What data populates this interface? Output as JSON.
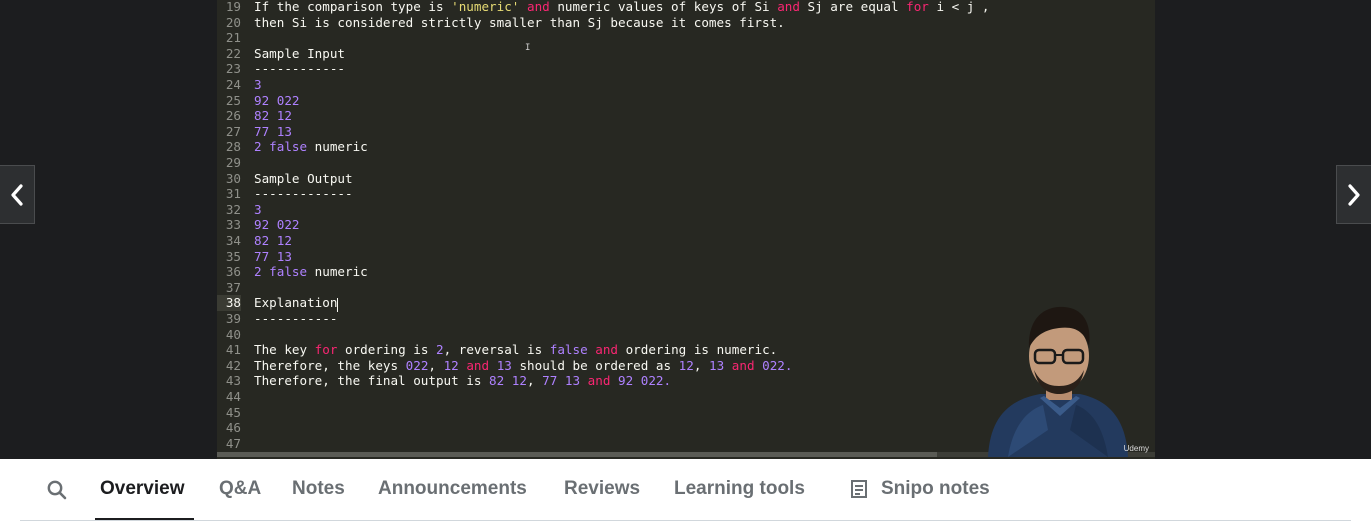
{
  "editor": {
    "active_line": "38",
    "lines": [
      {
        "n": "19",
        "tokens": [
          {
            "t": "If the comparison type is ",
            "c": "plain"
          },
          {
            "t": "'numeric'",
            "c": "str"
          },
          {
            "t": " ",
            "c": "plain"
          },
          {
            "t": "and",
            "c": "kw"
          },
          {
            "t": " numeric values of keys of Si ",
            "c": "plain"
          },
          {
            "t": "and",
            "c": "kw"
          },
          {
            "t": " Sj are equal ",
            "c": "plain"
          },
          {
            "t": "for",
            "c": "kw"
          },
          {
            "t": " i < j ,",
            "c": "plain"
          }
        ]
      },
      {
        "n": "20",
        "tokens": [
          {
            "t": "then Si is considered strictly smaller than Sj because it comes first.",
            "c": "plain"
          }
        ]
      },
      {
        "n": "21",
        "tokens": []
      },
      {
        "n": "22",
        "tokens": [
          {
            "t": "Sample Input",
            "c": "plain"
          }
        ]
      },
      {
        "n": "23",
        "tokens": [
          {
            "t": "------------",
            "c": "plain"
          }
        ]
      },
      {
        "n": "24",
        "tokens": [
          {
            "t": "3",
            "c": "num"
          }
        ]
      },
      {
        "n": "25",
        "tokens": [
          {
            "t": "92 022",
            "c": "num"
          }
        ]
      },
      {
        "n": "26",
        "tokens": [
          {
            "t": "82 12",
            "c": "num"
          }
        ]
      },
      {
        "n": "27",
        "tokens": [
          {
            "t": "77 13",
            "c": "num"
          }
        ]
      },
      {
        "n": "28",
        "tokens": [
          {
            "t": "2 false",
            "c": "num"
          },
          {
            "t": " numeric",
            "c": "plain"
          }
        ]
      },
      {
        "n": "29",
        "tokens": []
      },
      {
        "n": "30",
        "tokens": [
          {
            "t": "Sample Output",
            "c": "plain"
          }
        ]
      },
      {
        "n": "31",
        "tokens": [
          {
            "t": "-------------",
            "c": "plain"
          }
        ]
      },
      {
        "n": "32",
        "tokens": [
          {
            "t": "3",
            "c": "num"
          }
        ]
      },
      {
        "n": "33",
        "tokens": [
          {
            "t": "92 022",
            "c": "num"
          }
        ]
      },
      {
        "n": "34",
        "tokens": [
          {
            "t": "82 12",
            "c": "num"
          }
        ]
      },
      {
        "n": "35",
        "tokens": [
          {
            "t": "77 13",
            "c": "num"
          }
        ]
      },
      {
        "n": "36",
        "tokens": [
          {
            "t": "2 false",
            "c": "num"
          },
          {
            "t": " numeric",
            "c": "plain"
          }
        ]
      },
      {
        "n": "37",
        "tokens": []
      },
      {
        "n": "38",
        "tokens": [
          {
            "t": "Explanation",
            "c": "plain"
          }
        ]
      },
      {
        "n": "39",
        "tokens": [
          {
            "t": "-----------",
            "c": "plain"
          }
        ]
      },
      {
        "n": "40",
        "tokens": []
      },
      {
        "n": "41",
        "tokens": [
          {
            "t": "The key ",
            "c": "plain"
          },
          {
            "t": "for",
            "c": "kw"
          },
          {
            "t": " ordering is ",
            "c": "plain"
          },
          {
            "t": "2",
            "c": "num"
          },
          {
            "t": ", reversal is ",
            "c": "plain"
          },
          {
            "t": "false",
            "c": "num"
          },
          {
            "t": " ",
            "c": "plain"
          },
          {
            "t": "and",
            "c": "kw"
          },
          {
            "t": " ordering is numeric.",
            "c": "plain"
          }
        ]
      },
      {
        "n": "42",
        "tokens": [
          {
            "t": "Therefore, the keys ",
            "c": "plain"
          },
          {
            "t": "022",
            "c": "num"
          },
          {
            "t": ", ",
            "c": "plain"
          },
          {
            "t": "12",
            "c": "num"
          },
          {
            "t": " ",
            "c": "plain"
          },
          {
            "t": "and",
            "c": "kw"
          },
          {
            "t": " ",
            "c": "plain"
          },
          {
            "t": "13",
            "c": "num"
          },
          {
            "t": " should be ordered as ",
            "c": "plain"
          },
          {
            "t": "12",
            "c": "num"
          },
          {
            "t": ", ",
            "c": "plain"
          },
          {
            "t": "13",
            "c": "num"
          },
          {
            "t": " ",
            "c": "plain"
          },
          {
            "t": "and",
            "c": "kw"
          },
          {
            "t": " ",
            "c": "plain"
          },
          {
            "t": "022.",
            "c": "num"
          }
        ]
      },
      {
        "n": "43",
        "tokens": [
          {
            "t": "Therefore, the final output is ",
            "c": "plain"
          },
          {
            "t": "82 12",
            "c": "num"
          },
          {
            "t": ", ",
            "c": "plain"
          },
          {
            "t": "77 13",
            "c": "num"
          },
          {
            "t": " ",
            "c": "plain"
          },
          {
            "t": "and",
            "c": "kw"
          },
          {
            "t": " ",
            "c": "plain"
          },
          {
            "t": "92 022.",
            "c": "num"
          }
        ]
      },
      {
        "n": "44",
        "tokens": []
      },
      {
        "n": "45",
        "tokens": []
      },
      {
        "n": "46",
        "tokens": []
      },
      {
        "n": "47",
        "tokens": []
      }
    ]
  },
  "video": {
    "watermark": "Udemy",
    "prev_icon": "chevron-left-icon",
    "next_icon": "chevron-right-icon"
  },
  "tabs": {
    "search_icon": "search-icon",
    "items": [
      {
        "label": "Overview",
        "active": true
      },
      {
        "label": "Q&A"
      },
      {
        "label": "Notes"
      },
      {
        "label": "Announcements"
      },
      {
        "label": "Reviews"
      },
      {
        "label": "Learning tools"
      },
      {
        "label": "Snipo notes",
        "icon": "notes-list-icon"
      }
    ]
  },
  "colors": {
    "editor_bg": "#272822",
    "keyword": "#f92672",
    "number": "#ae81ff",
    "string": "#e6db74",
    "text": "#f8f8f2"
  }
}
